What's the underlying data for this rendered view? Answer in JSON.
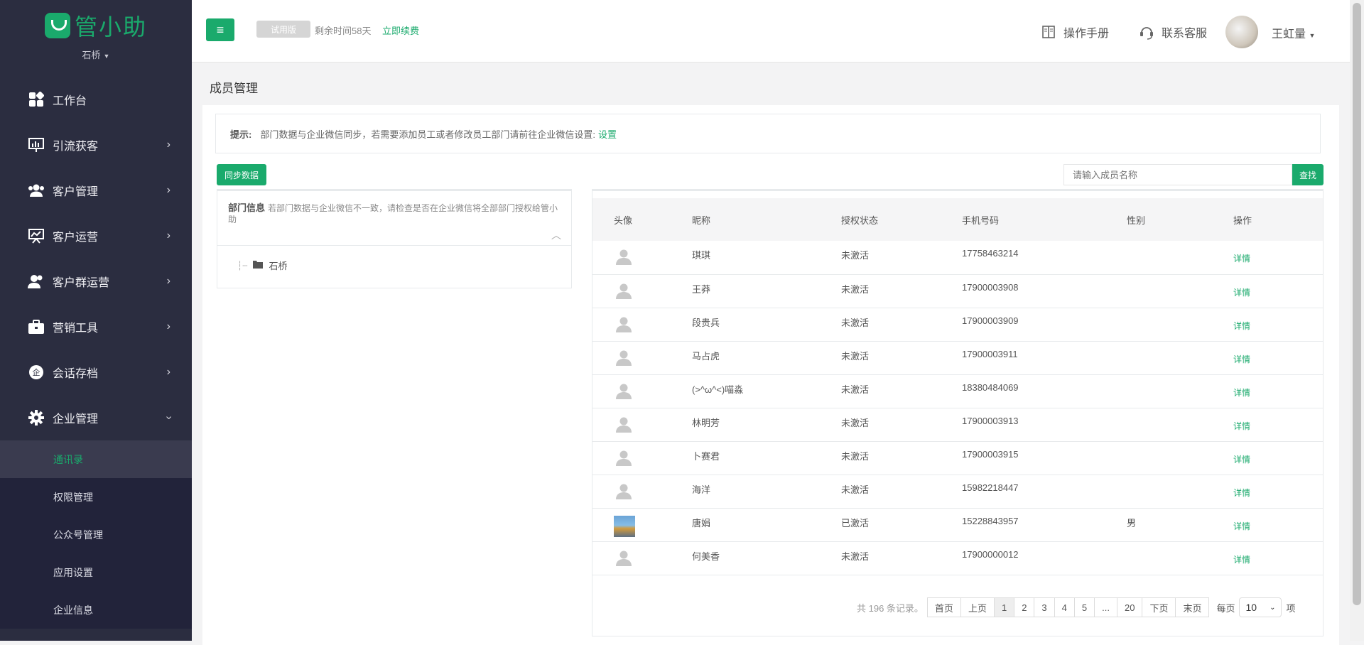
{
  "brand": {
    "logo_text": "管小助",
    "org": "石桥"
  },
  "nav": [
    {
      "label": "工作台",
      "icon": "dashboard-icon"
    },
    {
      "label": "引流获客",
      "icon": "chart-icon"
    },
    {
      "label": "客户管理",
      "icon": "users-icon"
    },
    {
      "label": "客户运营",
      "icon": "presentation-icon"
    },
    {
      "label": "客户群运营",
      "icon": "group-icon"
    },
    {
      "label": "营销工具",
      "icon": "briefcase-icon"
    },
    {
      "label": "会话存档",
      "icon": "chat-archive-icon"
    },
    {
      "label": "企业管理",
      "icon": "gear-icon"
    }
  ],
  "subnav": [
    "通讯录",
    "权限管理",
    "公众号管理",
    "应用设置",
    "企业信息"
  ],
  "topbar": {
    "trial": "试用版",
    "remain": "剩余时间58天",
    "renew": "立即续费",
    "manual": "操作手册",
    "support": "联系客服",
    "user": "王虹量"
  },
  "page": {
    "title": "成员管理",
    "tip_label": "提示:",
    "tip_text": "部门数据与企业微信同步，若需要添加员工或者修改员工部门请前往企业微信设置:",
    "tip_link": "设置",
    "sync_button": "同步数据",
    "search_placeholder": "请输入成员名称",
    "search_button": "查找",
    "dept_title": "部门信息",
    "dept_note": "若部门数据与企业微信不一致，请检查是否在企业微信将全部部门授权给管小助",
    "dept_root": "石桥"
  },
  "table": {
    "headers": [
      "头像",
      "昵称",
      "授权状态",
      "手机号码",
      "性别",
      "操作"
    ],
    "rows": [
      {
        "name": "琪琪",
        "status": "未激活",
        "phone": "17758463214",
        "gender": "",
        "op": "详情",
        "photo": false
      },
      {
        "name": "王莽",
        "status": "未激活",
        "phone": "17900003908",
        "gender": "",
        "op": "详情",
        "photo": false
      },
      {
        "name": "段贵兵",
        "status": "未激活",
        "phone": "17900003909",
        "gender": "",
        "op": "详情",
        "photo": false
      },
      {
        "name": "马占虎",
        "status": "未激活",
        "phone": "17900003911",
        "gender": "",
        "op": "详情",
        "photo": false
      },
      {
        "name": "(>^ω^<)喵淼",
        "status": "未激活",
        "phone": "18380484069",
        "gender": "",
        "op": "详情",
        "photo": false
      },
      {
        "name": "林明芳",
        "status": "未激活",
        "phone": "17900003913",
        "gender": "",
        "op": "详情",
        "photo": false
      },
      {
        "name": "卜赛君",
        "status": "未激活",
        "phone": "17900003915",
        "gender": "",
        "op": "详情",
        "photo": false
      },
      {
        "name": "海洋",
        "status": "未激活",
        "phone": "15982218447",
        "gender": "",
        "op": "详情",
        "photo": false
      },
      {
        "name": "唐娟",
        "status": "已激活",
        "phone": "15228843957",
        "gender": "男",
        "op": "详情",
        "photo": true
      },
      {
        "name": "何美香",
        "status": "未激活",
        "phone": "17900000012",
        "gender": "",
        "op": "详情",
        "photo": false
      }
    ]
  },
  "pagination": {
    "total": "共 196 条记录。",
    "first": "首页",
    "prev": "上页",
    "pages": [
      "1",
      "2",
      "3",
      "4",
      "5",
      "...",
      "20"
    ],
    "next": "下页",
    "last": "末页",
    "per_label": "每页",
    "per_value": "10",
    "per_unit": "项"
  },
  "colors": {
    "accent": "#1aaa6c",
    "sidebar": "#2b2d40"
  }
}
